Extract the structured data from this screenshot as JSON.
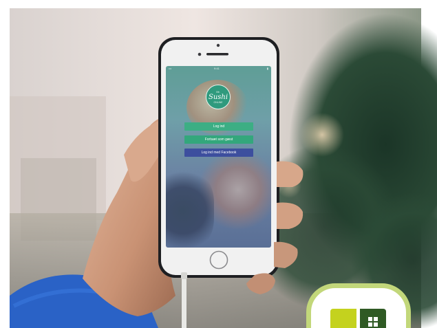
{
  "photo": {
    "subject": "hand holding smartphone",
    "colors": {
      "sky": "#eae3df",
      "foliage": "#1f3d2c",
      "phone_frame": "#1e1f22",
      "phone_body": "#f1f1f1",
      "sleeve": "#2a62c6",
      "skin": "#d3a58a"
    }
  },
  "app": {
    "status": {
      "left": "•••",
      "center": "9:41",
      "right": "▮"
    },
    "logo": {
      "line1": "Mr.",
      "line2": "Sushi",
      "line3": "ONLINE"
    },
    "buttons": {
      "login": "Log ind",
      "guest": "Fortsæt som gæst",
      "facebook": "Log ind med Facebook"
    },
    "colors": {
      "green": "#3cae84",
      "facebook": "#3d4f9e",
      "logo_bg": "#2f9a7d"
    }
  },
  "badge": {
    "colors": {
      "ring": "#c2d77a",
      "yellow": "#c4d21e",
      "dark_green": "#2f5a24"
    }
  }
}
